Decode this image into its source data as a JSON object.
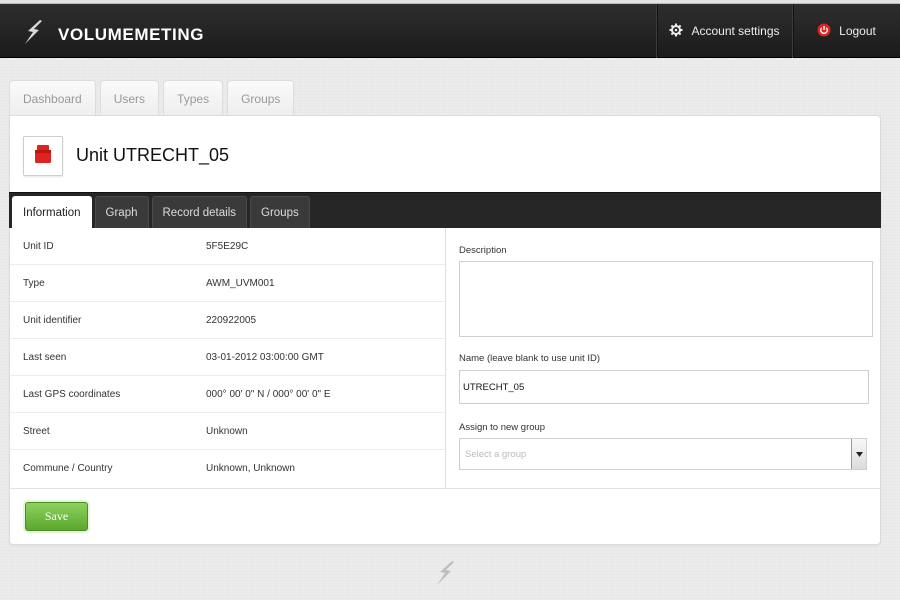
{
  "app": {
    "brand": "VOLUMEMETING",
    "account_label": "Account settings",
    "logout_label": "Logout",
    "icons": {
      "brand": "lightning-bolt-icon",
      "account": "gear-icon",
      "logout": "power-icon"
    }
  },
  "nav": {
    "tabs": [
      {
        "label": "Dashboard"
      },
      {
        "label": "Users"
      },
      {
        "label": "Types"
      },
      {
        "label": "Groups"
      }
    ]
  },
  "unit": {
    "title": "Unit UTRECHT_05",
    "icon": "red-unit-box-icon"
  },
  "subtabs": [
    {
      "label": "Information",
      "active": true
    },
    {
      "label": "Graph"
    },
    {
      "label": "Record details"
    },
    {
      "label": "Groups"
    }
  ],
  "info": [
    {
      "label": "Unit ID",
      "value": "5F5E29C"
    },
    {
      "label": "Type",
      "value": "AWM_UVM001"
    },
    {
      "label": "Unit identifier",
      "value": "220922005"
    },
    {
      "label": "Last seen",
      "value": "03-01-2012 03:00:00 GMT"
    },
    {
      "label": "Last GPS coordinates",
      "value": "000° 00' 0\" N / 000° 00' 0\" E"
    },
    {
      "label": "Street",
      "value": "Unknown"
    },
    {
      "label": "Commune / Country",
      "value": "Unknown, Unknown"
    }
  ],
  "form": {
    "description_label": "Description",
    "description_value": "",
    "name_label": "Name (leave blank to use unit ID)",
    "name_value": "UTRECHT_05",
    "group_label": "Assign to new group",
    "group_placeholder": "Select a group",
    "save_label": "Save"
  },
  "colors": {
    "header": "#1f1f1f",
    "save_green": "#6bbf3c",
    "accent_red": "#e0231f"
  }
}
